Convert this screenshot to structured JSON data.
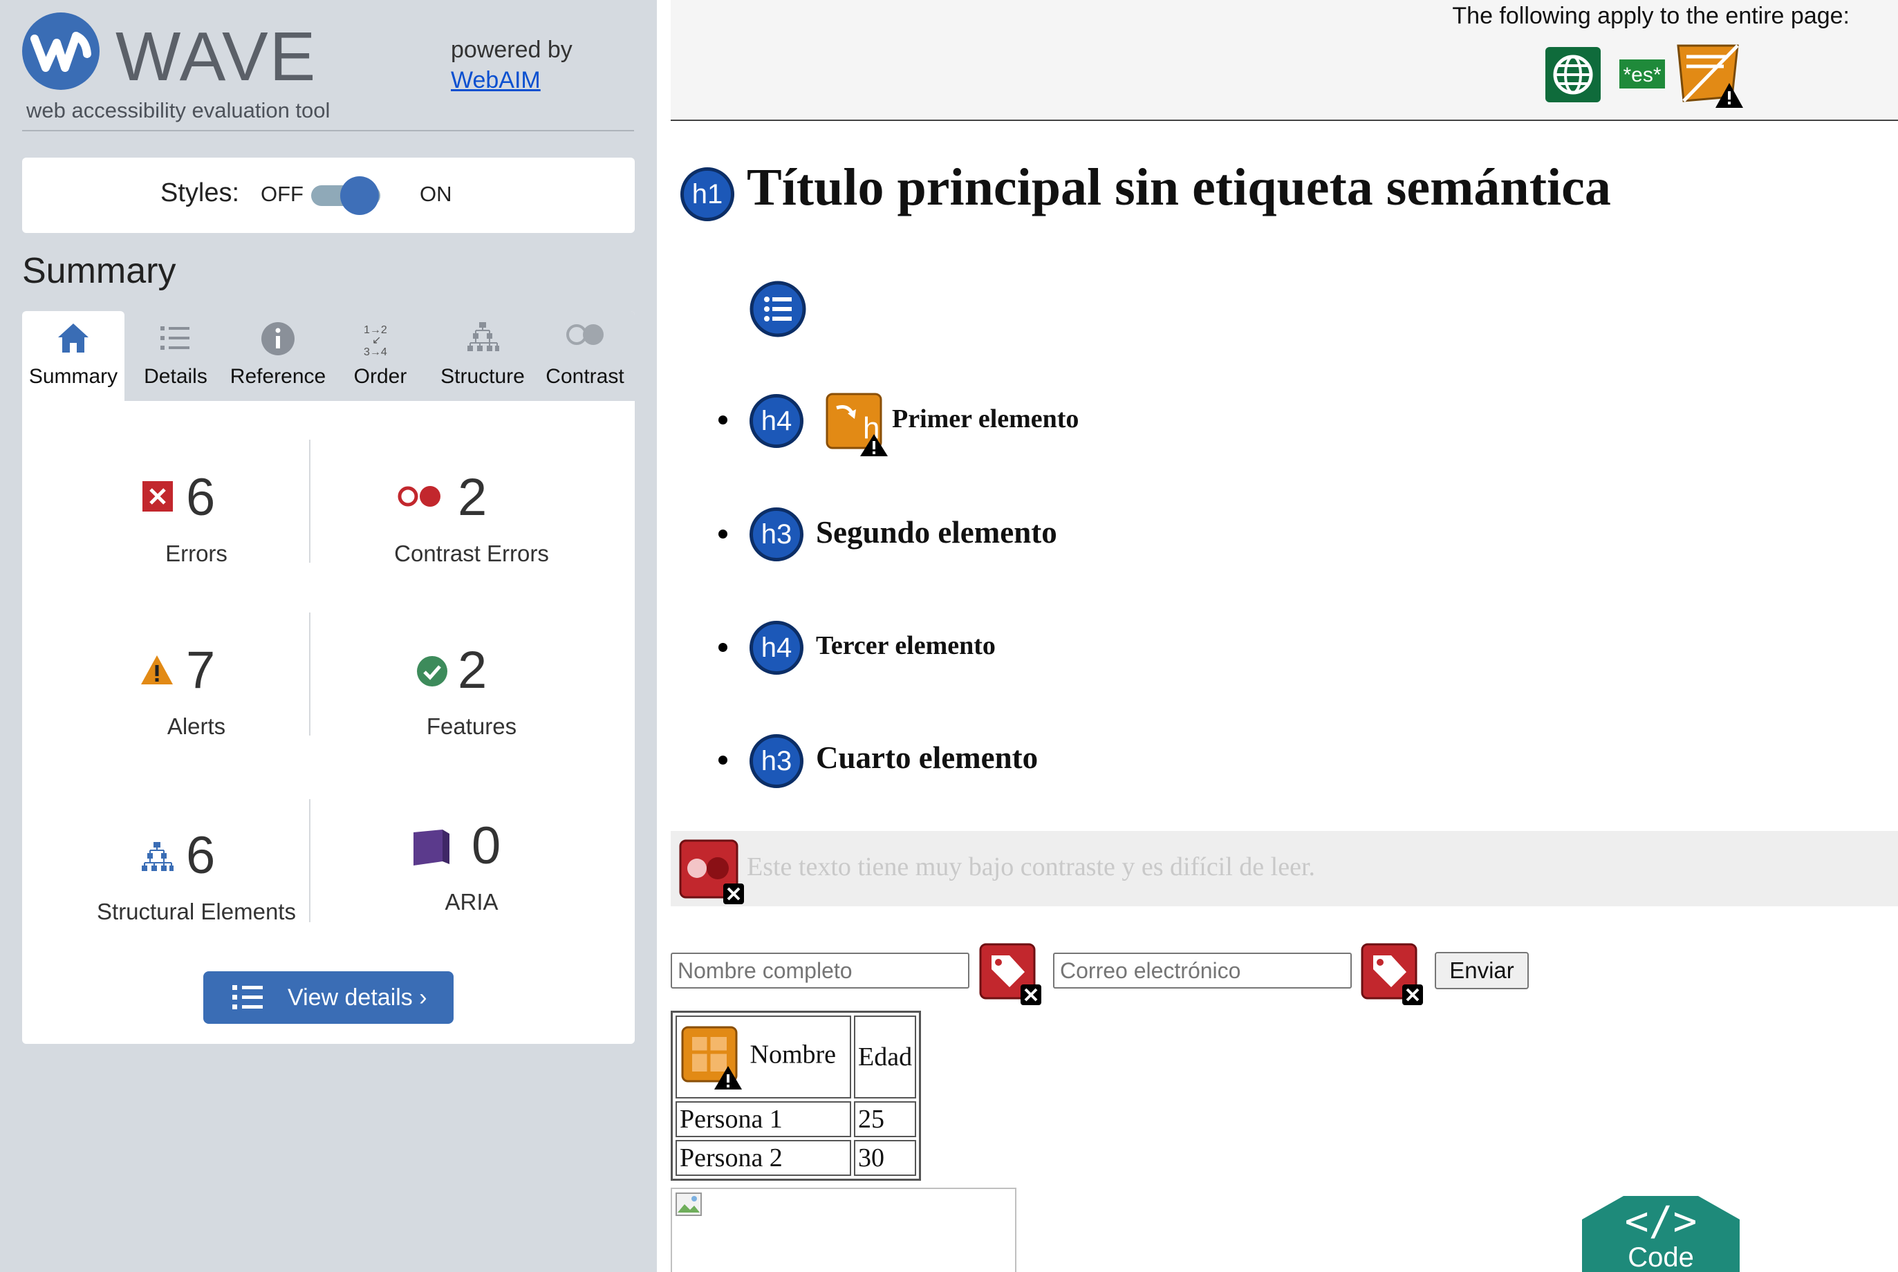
{
  "sidebar": {
    "logo_word": "WAVE",
    "logo_tagline": "web accessibility evaluation tool",
    "powered_by": "powered by",
    "powered_link": "WebAIM",
    "styles_label": "Styles:",
    "styles_off": "OFF",
    "styles_on": "ON",
    "styles_state": "on",
    "summary_heading": "Summary",
    "tabs": [
      {
        "label": "Summary",
        "icon": "home-icon",
        "active": true
      },
      {
        "label": "Details",
        "icon": "list-icon",
        "active": false
      },
      {
        "label": "Reference",
        "icon": "info-icon",
        "active": false
      },
      {
        "label": "Order",
        "icon": "order-icon",
        "active": false
      },
      {
        "label": "Structure",
        "icon": "structure-icon",
        "active": false
      },
      {
        "label": "Contrast",
        "icon": "contrast-icon",
        "active": false
      }
    ],
    "stats": {
      "errors": {
        "count": "6",
        "label": "Errors",
        "color": "#c2272d"
      },
      "contrast_errors": {
        "count": "2",
        "label": "Contrast Errors",
        "color": "#c2272d"
      },
      "alerts": {
        "count": "7",
        "label": "Alerts",
        "color": "#e28a15"
      },
      "features": {
        "count": "2",
        "label": "Features",
        "color": "#3d8b5b"
      },
      "structural": {
        "count": "6",
        "label": "Structural Elements",
        "color": "#3a6db5"
      },
      "aria": {
        "count": "0",
        "label": "ARIA",
        "color": "#5b3a8c"
      }
    },
    "view_details": "View details ›"
  },
  "page": {
    "apply_text": "The following apply to the entire page:",
    "page_icons": [
      "language-icon",
      "lang-es-icon",
      "page-title-alert-icon"
    ],
    "lang_code": "*es*",
    "h1_badge": "h1",
    "h1_title": "Título principal sin etiqueta semántica",
    "list_items": [
      {
        "badge": "h4",
        "text": "Primer elemento",
        "alert": "skipped-heading-icon"
      },
      {
        "badge": "h3",
        "text": "Segundo elemento"
      },
      {
        "badge": "h4",
        "text": "Tercer elemento"
      },
      {
        "badge": "h3",
        "text": "Cuarto elemento"
      }
    ],
    "low_contrast_text": "Este texto tiene muy bajo contraste y es difícil de leer.",
    "form": {
      "name_placeholder": "Nombre completo",
      "email_placeholder": "Correo electrónico",
      "submit_label": "Enviar"
    },
    "table": {
      "headers": [
        "Nombre",
        "Edad"
      ],
      "rows": [
        [
          "Persona 1",
          "25"
        ],
        [
          "Persona 2",
          "30"
        ]
      ]
    },
    "code_button": "Code"
  }
}
